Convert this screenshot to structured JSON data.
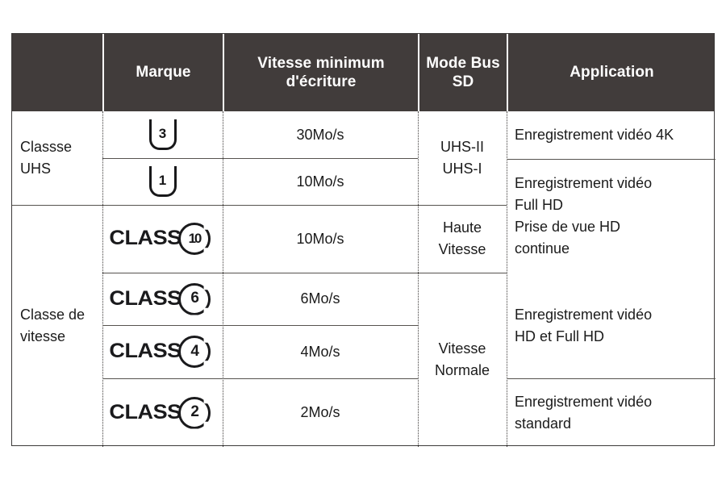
{
  "table": {
    "columns": [
      {
        "key": "category",
        "label": ""
      },
      {
        "key": "marque",
        "label": "Marque"
      },
      {
        "key": "vitesse",
        "label": "Vitesse minimum\nd'écriture"
      },
      {
        "key": "mode",
        "label": "Mode\nBus SD"
      },
      {
        "key": "application",
        "label": "Application"
      }
    ],
    "categories": [
      {
        "id": "uhs",
        "label": "Classse\nUHS"
      },
      {
        "id": "speed",
        "label": "Classe de\nvitesse"
      }
    ],
    "marques": [
      {
        "id": "u3",
        "type": "uhs-bucket-logo",
        "symbol": "U",
        "number": "3",
        "alt": "UHS Speed Class 3"
      },
      {
        "id": "u1",
        "type": "uhs-bucket-logo",
        "symbol": "U",
        "number": "1",
        "alt": "UHS Speed Class 1"
      },
      {
        "id": "c10",
        "type": "class-circle-logo",
        "word": "CLASS",
        "number": "10",
        "alt": "Speed Class 10"
      },
      {
        "id": "c6",
        "type": "class-circle-logo",
        "word": "CLASS",
        "number": "6",
        "alt": "Speed Class 6"
      },
      {
        "id": "c4",
        "type": "class-circle-logo",
        "word": "CLASS",
        "number": "4",
        "alt": "Speed Class 4"
      },
      {
        "id": "c2",
        "type": "class-circle-logo",
        "word": "CLASS",
        "number": "2",
        "alt": "Speed Class 2"
      }
    ],
    "speeds": [
      {
        "id": "s30",
        "value": "30Mo/s"
      },
      {
        "id": "s10a",
        "value": "10Mo/s"
      },
      {
        "id": "s10b",
        "value": "10Mo/s"
      },
      {
        "id": "s6",
        "value": "6Mo/s"
      },
      {
        "id": "s4",
        "value": "4Mo/s"
      },
      {
        "id": "s2",
        "value": "2Mo/s"
      }
    ],
    "bus_modes": [
      {
        "id": "uhs-bus",
        "label": "UHS-II\nUHS-I"
      },
      {
        "id": "haute",
        "label": "Haute\nVitesse"
      },
      {
        "id": "normale",
        "label": "Vitesse\nNormale"
      }
    ],
    "applications": [
      {
        "id": "app4k",
        "label": "Enregistrement vidéo 4K"
      },
      {
        "id": "appfhd",
        "label": "Enregistrement vidéo\nFull HD\nPrise de vue HD\ncontinue"
      },
      {
        "id": "apphd",
        "label": "Enregistrement vidéo\nHD et Full HD"
      },
      {
        "id": "appstd",
        "label": "Enregistrement vidéo\nstandard"
      }
    ]
  },
  "colors": {
    "header_background": "#413C3B",
    "header_text": "#FFFFFF",
    "body_text": "#1B1B1B",
    "border": "#3C3A39",
    "rule": "#56534F",
    "page_background": "#FFFFFF"
  }
}
